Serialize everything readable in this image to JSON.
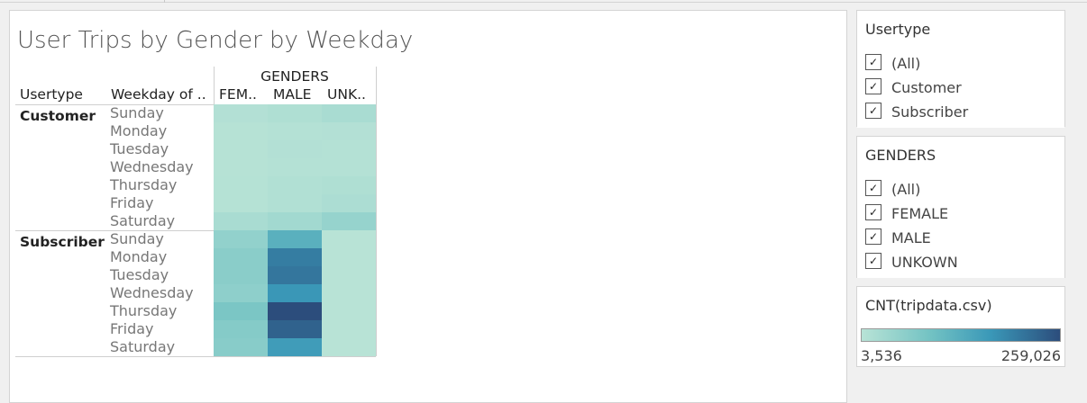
{
  "chart_data": {
    "type": "heatmap",
    "title": "User Trips by Gender by Weekday",
    "column_group_label": "GENDERS",
    "row_header_1": "Usertype",
    "row_header_2": "Weekday of ..",
    "columns": [
      "FEM..",
      "MALE",
      "UNK.."
    ],
    "row_groups": [
      {
        "name": "Customer",
        "rows": [
          {
            "day": "Sunday",
            "values": [
              10000,
              15000,
              22000
            ]
          },
          {
            "day": "Monday",
            "values": [
              6000,
              9000,
              10000
            ]
          },
          {
            "day": "Tuesday",
            "values": [
              6000,
              10000,
              9000
            ]
          },
          {
            "day": "Wednesday",
            "values": [
              6000,
              9000,
              9000
            ]
          },
          {
            "day": "Thursday",
            "values": [
              7000,
              12000,
              15000
            ]
          },
          {
            "day": "Friday",
            "values": [
              7000,
              12000,
              18000
            ]
          },
          {
            "day": "Saturday",
            "values": [
              22000,
              30000,
              45000
            ]
          }
        ]
      },
      {
        "name": "Subscriber",
        "rows": [
          {
            "day": "Sunday",
            "values": [
              50000,
              125000,
              3536
            ]
          },
          {
            "day": "Monday",
            "values": [
              60000,
              205000,
              3536
            ]
          },
          {
            "day": "Tuesday",
            "values": [
              60000,
              212000,
              3536
            ]
          },
          {
            "day": "Wednesday",
            "values": [
              55000,
              175000,
              3536
            ]
          },
          {
            "day": "Thursday",
            "values": [
              78000,
              259026,
              3536
            ]
          },
          {
            "day": "Friday",
            "values": [
              65000,
              235000,
              3536
            ]
          },
          {
            "day": "Saturday",
            "values": [
              62000,
              165000,
              3536
            ]
          }
        ]
      }
    ],
    "color_scale": {
      "min": 3536,
      "max": 259026,
      "min_label": "3,536",
      "max_label": "259,026",
      "colors": [
        "#b8e3d6",
        "#72c2c3",
        "#3a98b8",
        "#2c4d7c"
      ]
    }
  },
  "filters": {
    "usertype": {
      "title": "Usertype",
      "options": [
        {
          "label": "(All)",
          "checked": true
        },
        {
          "label": "Customer",
          "checked": true
        },
        {
          "label": "Subscriber",
          "checked": true
        }
      ]
    },
    "genders": {
      "title": "GENDERS",
      "options": [
        {
          "label": "(All)",
          "checked": true
        },
        {
          "label": "FEMALE",
          "checked": true
        },
        {
          "label": "MALE",
          "checked": true
        },
        {
          "label": "UNKOWN",
          "checked": true
        }
      ]
    }
  },
  "legend": {
    "title": "CNT(tripdata.csv)"
  },
  "check_glyph": "✓"
}
